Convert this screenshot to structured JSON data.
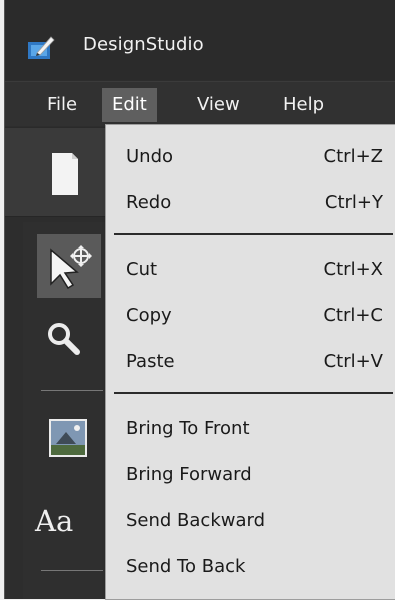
{
  "app": {
    "title": "DesignStudio",
    "icon": "design-studio-app-icon"
  },
  "menubar": {
    "items": [
      {
        "label": "File",
        "active": false
      },
      {
        "label": "Edit",
        "active": true
      },
      {
        "label": "View",
        "active": false
      },
      {
        "label": "Help",
        "active": false
      }
    ]
  },
  "toolbar": {
    "icons": [
      "new-document-icon"
    ]
  },
  "tools": {
    "icons": [
      "pointer-tool-icon",
      "zoom-tool-icon",
      "image-tool-icon",
      "text-tool-icon"
    ],
    "text_tool_glyph": "Aa"
  },
  "edit_menu": {
    "groups": [
      [
        {
          "label": "Undo",
          "shortcut": "Ctrl+Z"
        },
        {
          "label": "Redo",
          "shortcut": "Ctrl+Y"
        }
      ],
      [
        {
          "label": "Cut",
          "shortcut": "Ctrl+X"
        },
        {
          "label": "Copy",
          "shortcut": "Ctrl+C"
        },
        {
          "label": "Paste",
          "shortcut": "Ctrl+V"
        }
      ],
      [
        {
          "label": "Bring To Front",
          "shortcut": ""
        },
        {
          "label": "Bring Forward",
          "shortcut": ""
        },
        {
          "label": "Send Backward",
          "shortcut": ""
        },
        {
          "label": "Send To Back",
          "shortcut": ""
        }
      ]
    ]
  },
  "colors": {
    "window_bg": "#2d2d2d",
    "menu_active_bg": "#5f5f5f",
    "dropdown_bg": "#e1e1e1",
    "text_light": "#f2f2f2",
    "text_dark": "#1a1a1a"
  }
}
